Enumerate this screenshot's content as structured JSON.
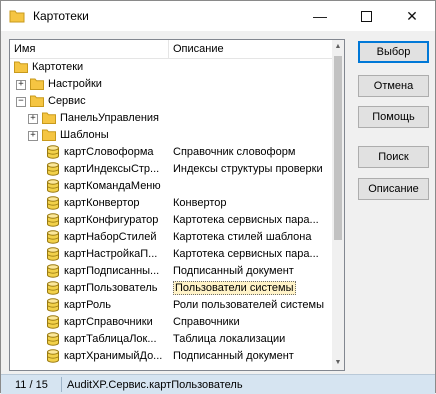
{
  "window": {
    "title": "Картотеки",
    "minimize_glyph": "—",
    "close_glyph": "✕"
  },
  "tree": {
    "columns": {
      "name": "Имя",
      "description": "Описание"
    },
    "rows": [
      {
        "level": 0,
        "kind": "folder",
        "expander": "",
        "name": "Картотеки",
        "desc": ""
      },
      {
        "level": 1,
        "kind": "folder",
        "expander": "+",
        "name": "Настройки",
        "desc": ""
      },
      {
        "level": 1,
        "kind": "folder",
        "expander": "−",
        "name": "Сервис",
        "desc": ""
      },
      {
        "level": 2,
        "kind": "folder",
        "expander": "+",
        "name": "ПанельУправления",
        "desc": ""
      },
      {
        "level": 2,
        "kind": "folder",
        "expander": "+",
        "name": "Шаблоны",
        "desc": ""
      },
      {
        "level": 3,
        "kind": "db",
        "expander": "",
        "name": "картСловоформа",
        "desc": "Справочник словоформ"
      },
      {
        "level": 3,
        "kind": "db",
        "expander": "",
        "name": "картИндексыСтр...",
        "desc": "Индексы структуры проверки"
      },
      {
        "level": 3,
        "kind": "db",
        "expander": "",
        "name": "картКомандаМеню",
        "desc": ""
      },
      {
        "level": 3,
        "kind": "db",
        "expander": "",
        "name": "картКонвертор",
        "desc": "Конвертор"
      },
      {
        "level": 3,
        "kind": "db",
        "expander": "",
        "name": "картКонфигуратор",
        "desc": "Картотека сервисных пара..."
      },
      {
        "level": 3,
        "kind": "db",
        "expander": "",
        "name": "картНаборСтилей",
        "desc": "Картотека стилей шаблона"
      },
      {
        "level": 3,
        "kind": "db",
        "expander": "",
        "name": "картНастройкаП...",
        "desc": "Картотека сервисных пара..."
      },
      {
        "level": 3,
        "kind": "db",
        "expander": "",
        "name": "картПодписанны...",
        "desc": "Подписанный документ"
      },
      {
        "level": 3,
        "kind": "db",
        "expander": "",
        "name": "картПользователь",
        "desc": "Пользователи системы",
        "selected": true
      },
      {
        "level": 3,
        "kind": "db",
        "expander": "",
        "name": "картРоль",
        "desc": "Роли пользователей системы"
      },
      {
        "level": 3,
        "kind": "db",
        "expander": "",
        "name": "картСправочники",
        "desc": "Справочники"
      },
      {
        "level": 3,
        "kind": "db",
        "expander": "",
        "name": "картТаблицаЛок...",
        "desc": "Таблица локализации"
      },
      {
        "level": 3,
        "kind": "db",
        "expander": "",
        "name": "картХранимыйДо...",
        "desc": "Подписанный документ"
      }
    ]
  },
  "buttons": {
    "select": "Выбор",
    "cancel": "Отмена",
    "help": "Помощь",
    "search": "Поиск",
    "description": "Описание"
  },
  "status": {
    "position": "11 / 15",
    "path": "AuditXP.Сервис.картПользователь"
  },
  "colors": {
    "status_bar": "#d6e4f1",
    "default_button_border": "#0078d7",
    "selection_fill": "#fff3c8",
    "folder": "#f5c542",
    "database": "#f2d14a"
  }
}
